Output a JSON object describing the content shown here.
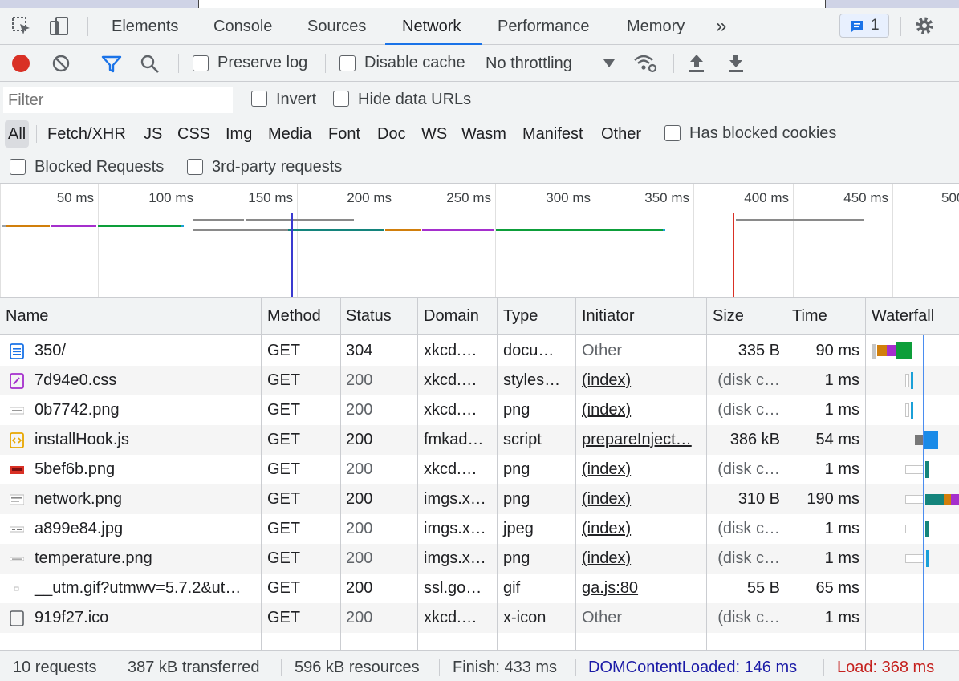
{
  "tabs": {
    "elements": "Elements",
    "console": "Console",
    "sources": "Sources",
    "network": "Network",
    "performance": "Performance",
    "memory": "Memory",
    "more": "»",
    "message_count": "1"
  },
  "toolbar": {
    "preserve_log": "Preserve log",
    "disable_cache": "Disable cache",
    "throttling": "No throttling"
  },
  "filter": {
    "placeholder": "Filter",
    "invert": "Invert",
    "hide_data_urls": "Hide data URLs",
    "types": [
      "All",
      "Fetch/XHR",
      "JS",
      "CSS",
      "Img",
      "Media",
      "Font",
      "Doc",
      "WS",
      "Wasm",
      "Manifest",
      "Other"
    ],
    "has_blocked_cookies": "Has blocked cookies",
    "blocked_requests": "Blocked Requests",
    "third_party": "3rd-party requests"
  },
  "overview": {
    "ticks": [
      "50 ms",
      "100 ms",
      "150 ms",
      "200 ms",
      "250 ms",
      "300 ms",
      "350 ms",
      "400 ms",
      "450 ms",
      "500"
    ]
  },
  "columns": {
    "name": "Name",
    "method": "Method",
    "status": "Status",
    "domain": "Domain",
    "type": "Type",
    "initiator": "Initiator",
    "size": "Size",
    "time": "Time",
    "waterfall": "Waterfall"
  },
  "rows": [
    {
      "name": "350/",
      "method": "GET",
      "status": "304",
      "domain": "xkcd.…",
      "type": "docu…",
      "initiator": "Other",
      "size": "335 B",
      "time": "90 ms"
    },
    {
      "name": "7d94e0.css",
      "method": "GET",
      "status": "200",
      "domain": "xkcd.…",
      "type": "styles…",
      "initiator": "(index)",
      "size": "(disk c…",
      "time": "1 ms"
    },
    {
      "name": "0b7742.png",
      "method": "GET",
      "status": "200",
      "domain": "xkcd.…",
      "type": "png",
      "initiator": "(index)",
      "size": "(disk c…",
      "time": "1 ms"
    },
    {
      "name": "installHook.js",
      "method": "GET",
      "status": "200",
      "domain": "fmkad…",
      "type": "script",
      "initiator": "prepareInject…",
      "size": "386 kB",
      "time": "54 ms"
    },
    {
      "name": "5bef6b.png",
      "method": "GET",
      "status": "200",
      "domain": "xkcd.…",
      "type": "png",
      "initiator": "(index)",
      "size": "(disk c…",
      "time": "1 ms"
    },
    {
      "name": "network.png",
      "method": "GET",
      "status": "200",
      "domain": "imgs.x…",
      "type": "png",
      "initiator": "(index)",
      "size": "310 B",
      "time": "190 ms"
    },
    {
      "name": "a899e84.jpg",
      "method": "GET",
      "status": "200",
      "domain": "imgs.x…",
      "type": "jpeg",
      "initiator": "(index)",
      "size": "(disk c…",
      "time": "1 ms"
    },
    {
      "name": "temperature.png",
      "method": "GET",
      "status": "200",
      "domain": "imgs.x…",
      "type": "png",
      "initiator": "(index)",
      "size": "(disk c…",
      "time": "1 ms"
    },
    {
      "name": "__utm.gif?utmwv=5.7.2&ut…",
      "method": "GET",
      "status": "200",
      "domain": "ssl.go…",
      "type": "gif",
      "initiator": "ga.js:80",
      "size": "55 B",
      "time": "65 ms"
    },
    {
      "name": "919f27.ico",
      "method": "GET",
      "status": "200",
      "domain": "xkcd.…",
      "type": "x-icon",
      "initiator": "Other",
      "size": "(disk c…",
      "time": "1 ms"
    }
  ],
  "status": {
    "requests": "10 requests",
    "transferred": "387 kB transferred",
    "resources": "596 kB resources",
    "finish": "Finish: 433 ms",
    "dcl": "DOMContentLoaded: 146 ms",
    "load": "Load: 368 ms"
  },
  "colors": {
    "accent": "#1a73e8",
    "record": "#d93025",
    "dcl": "#1a1aa6",
    "load": "#c5221f"
  }
}
